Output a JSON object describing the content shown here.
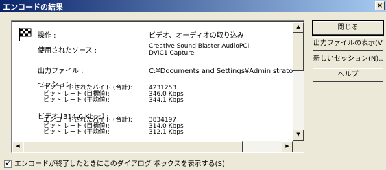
{
  "window": {
    "title": "エンコードの結果",
    "close_label": "×"
  },
  "summary": {
    "operation_label": "操作 :",
    "operation_value": "ビデオ、オーディオの取り込み",
    "source_label": "使用されたソース :",
    "source_value_1": "Creative Sound Blaster AudioPCI",
    "source_value_2": "DVIC1 Capture",
    "output_label": "出力ファイル :",
    "output_value": "C:¥Documents and Settings¥Administrator¥デスク",
    "session_header": "セッション :",
    "session_rows": [
      {
        "label": "エンコードされたバイト (合計):",
        "value": "4231253"
      },
      {
        "label": "ビット レート (目標値):",
        "value": "346.0 Kbps"
      },
      {
        "label": "ビット レート (平均値):",
        "value": "344.1 Kbps"
      }
    ],
    "video_header": "ビデオ [314.0 Kbps] :",
    "video_rows": [
      {
        "label": "エンコードされたバイト (合計):",
        "value": "3834197"
      },
      {
        "label": "ビット レート (目標値):",
        "value": "314.0 Kbps"
      },
      {
        "label": "ビット レート (平均値):",
        "value": "312.1 Kbps"
      }
    ]
  },
  "buttons": {
    "close": "閉じる",
    "show_output": "出力ファイルの表示(V)",
    "new_session": "新しいセッション(N)...",
    "help": "ヘルプ"
  },
  "checkbox": {
    "label": "エンコードが終了したときにこのダイアログ ボックスを表示する(S)",
    "checked": true,
    "mark": "✔"
  },
  "scroll": {
    "up": "▲",
    "down": "▼",
    "left": "◀",
    "right": "▶"
  }
}
